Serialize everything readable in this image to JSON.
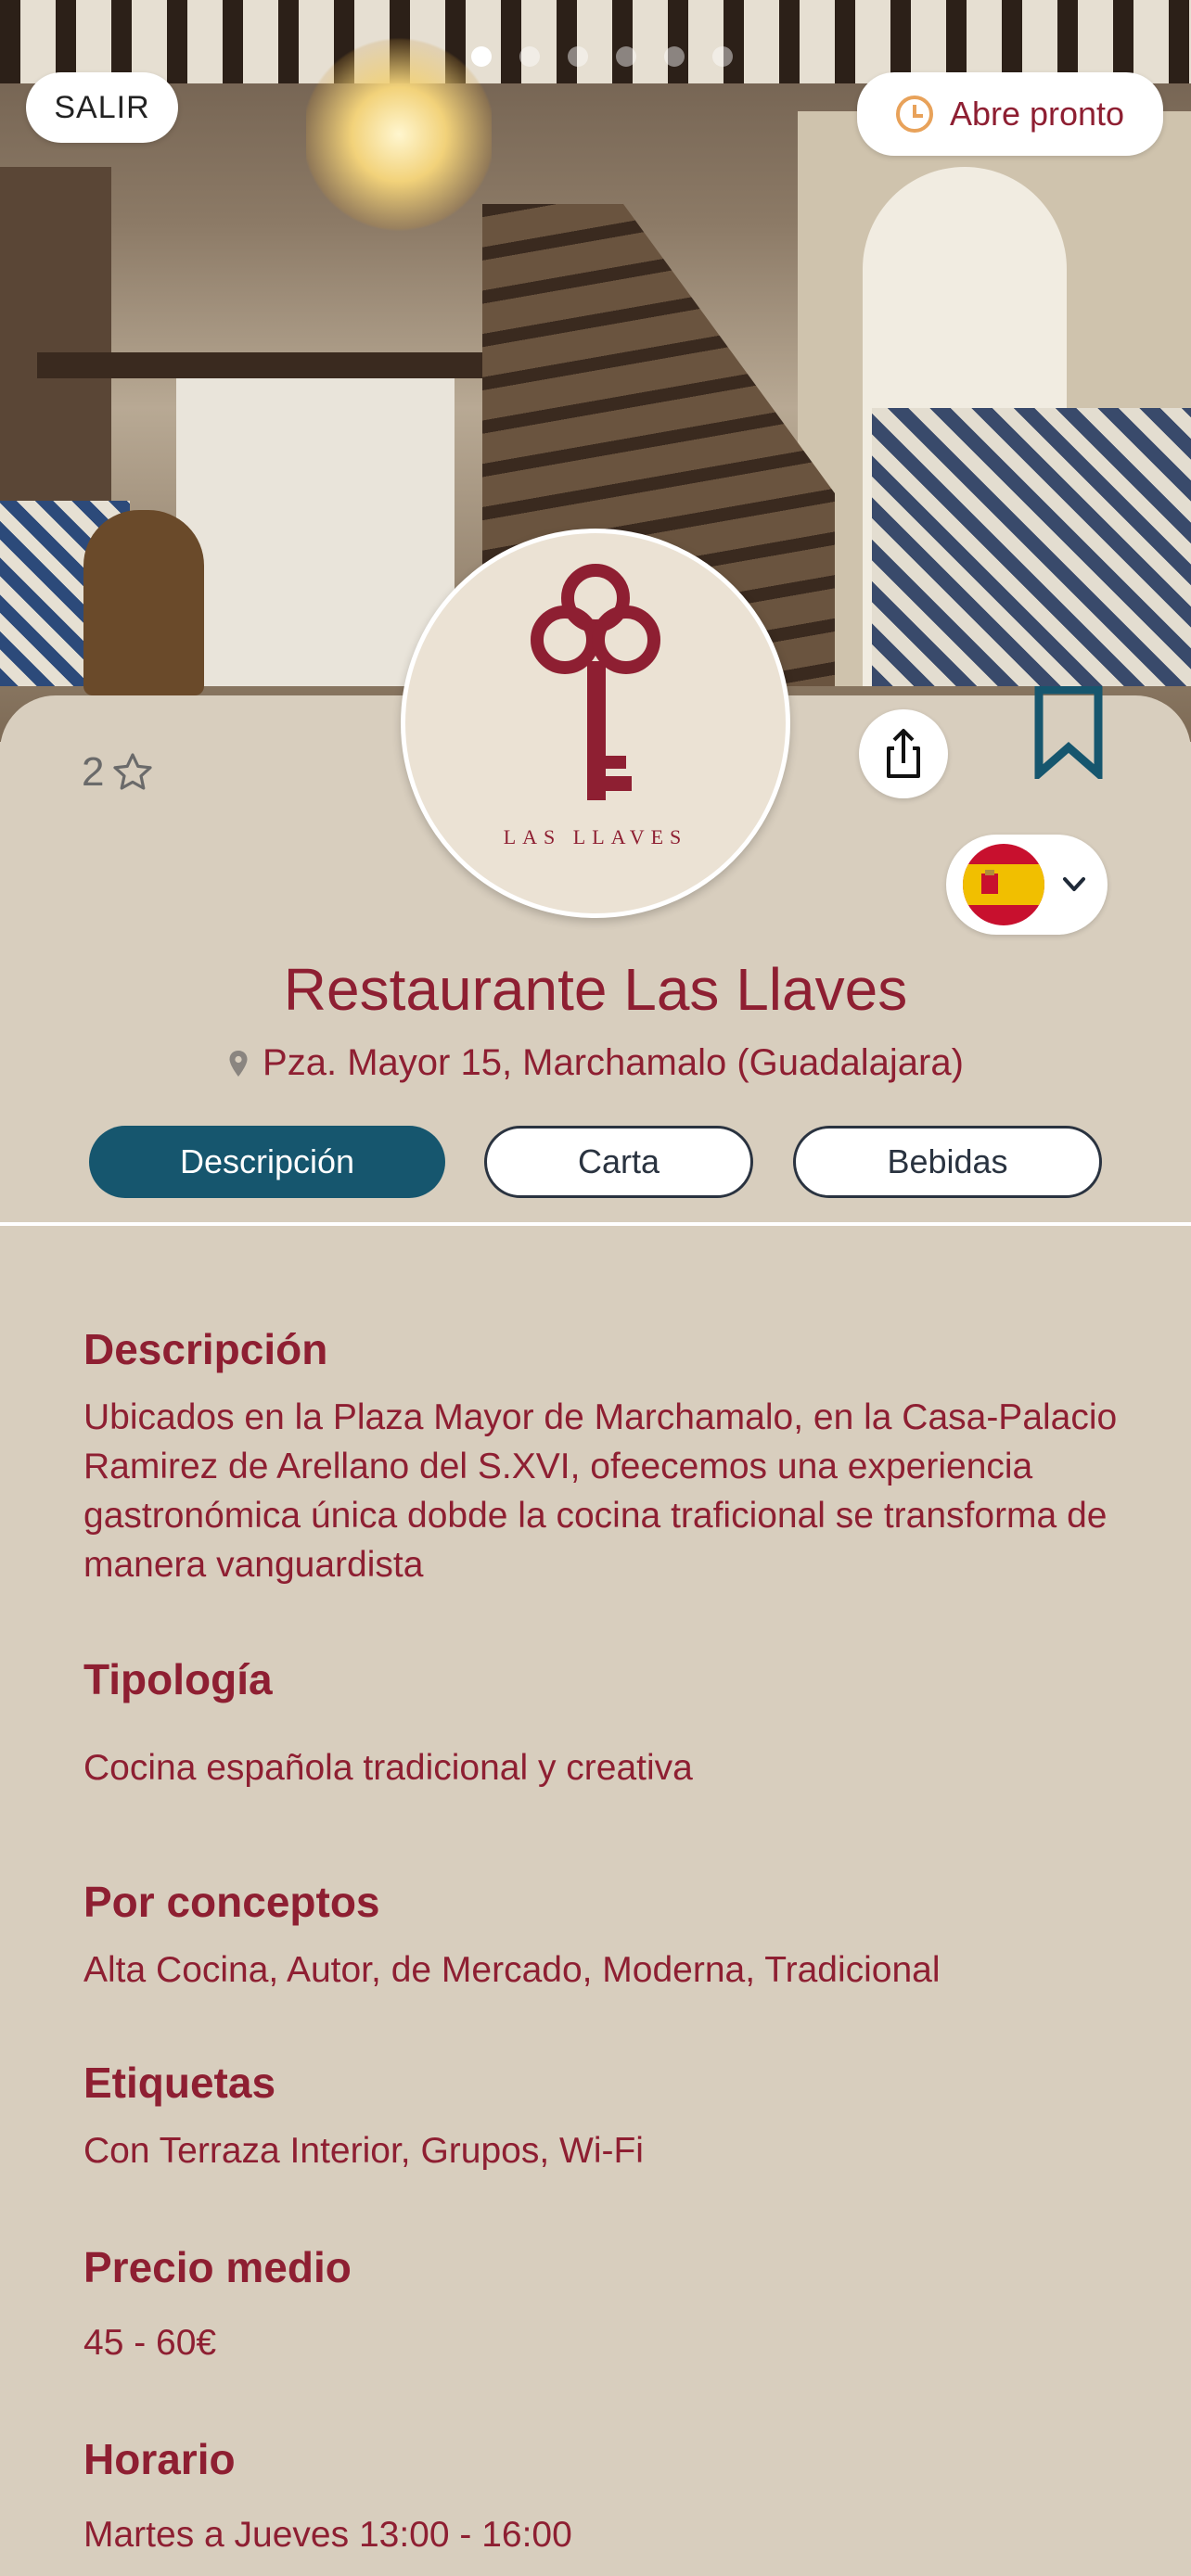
{
  "hero": {
    "exit_label": "SALIR",
    "status_label": "Abre pronto",
    "carousel": {
      "total": 6,
      "active_index": 0
    }
  },
  "restaurant": {
    "logo_text": "LAS LLAVES",
    "rating": "2",
    "name": "Restaurante Las Llaves",
    "address": "Pza. Mayor 15, Marchamalo (Guadalajara)"
  },
  "language": {
    "selected_flag": "spain-flag-icon"
  },
  "tabs": [
    {
      "label": "Descripción",
      "active": true
    },
    {
      "label": "Carta",
      "active": false
    },
    {
      "label": "Bebidas",
      "active": false
    }
  ],
  "sections": {
    "description_title": "Descripción",
    "description_text": "Ubicados en la Plaza Mayor de Marchamalo, en la Casa-Palacio Ramirez de Arellano del S.XVI, ofeecemos una experiencia gastronómica única dobde la cocina traficional se transforma de manera vanguardista",
    "typology_title": "Tipología",
    "typology_text": "Cocina española tradicional y creativa",
    "concepts_title": "Por conceptos",
    "concepts_text": "Alta Cocina, Autor, de Mercado, Moderna, Tradicional",
    "tags_title": "Etiquetas",
    "tags_text": "Con Terraza Interior, Grupos, Wi-Fi",
    "price_title": "Precio medio",
    "price_text": "45 - 60€",
    "hours_title": "Horario",
    "hours_text": "Martes a Jueves 13:00 - 16:00"
  },
  "colors": {
    "brand": "#8e1f32",
    "accent": "#16566e",
    "background": "#d8cebe",
    "status_icon": "#e8a25a"
  }
}
